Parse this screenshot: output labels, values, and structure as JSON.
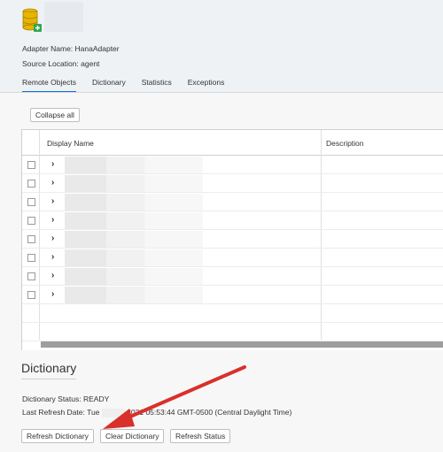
{
  "adapter": {
    "name_label": "Adapter Name: HanaAdapter",
    "location_label": "Source Location: agent"
  },
  "tabs": [
    {
      "label": "Remote Objects",
      "active": true
    },
    {
      "label": "Dictionary",
      "active": false
    },
    {
      "label": "Statistics",
      "active": false
    },
    {
      "label": "Exceptions",
      "active": false
    }
  ],
  "toolbar": {
    "collapse_label": "Collapse all"
  },
  "table": {
    "columns": [
      "Display Name",
      "Description"
    ],
    "row_count": 8
  },
  "dictionary": {
    "title": "Dictionary",
    "status_line": "Dictionary Status: READY",
    "refresh_prefix": "Last Refresh Date: Tue",
    "refresh_suffix": "2021 05:53:44 GMT-0500 (Central Daylight Time)"
  },
  "buttons": {
    "refresh": "Refresh Dictionary",
    "clear": "Clear Dictionary",
    "status": "Refresh Status"
  },
  "colors": {
    "active_tab": "#0a6ed1",
    "annotation_arrow": "#d9302b",
    "adapter_icon": "#e8b400"
  },
  "icons": {
    "adapter": "database-icon",
    "expand": "chevron-right-icon"
  }
}
